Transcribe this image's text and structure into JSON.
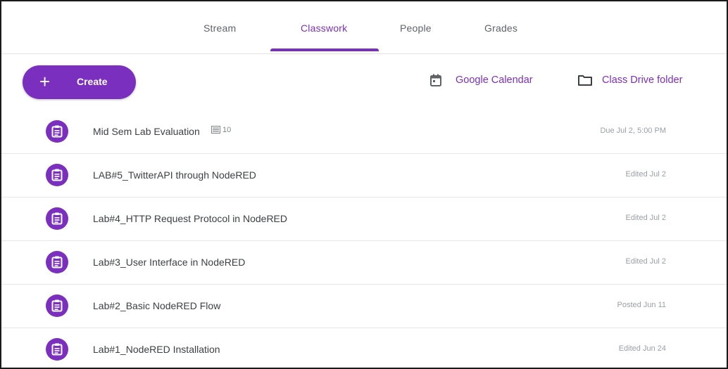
{
  "tabs": [
    {
      "label": "Stream",
      "active": false
    },
    {
      "label": "Classwork",
      "active": true
    },
    {
      "label": "People",
      "active": false
    },
    {
      "label": "Grades",
      "active": false
    }
  ],
  "toolbar": {
    "create_label": "Create",
    "calendar_label": "Google Calendar",
    "drive_label": "Class Drive folder"
  },
  "items": [
    {
      "title": "Mid Sem Lab Evaluation",
      "comment_count": "10",
      "meta": "Due Jul 2, 5:00 PM",
      "icon": "assignment-icon"
    },
    {
      "title": "LAB#5_TwitterAPI through NodeRED",
      "meta": "Edited Jul 2",
      "icon": "assignment-icon"
    },
    {
      "title": "Lab#4_HTTP Request Protocol in NodeRED",
      "meta": "Edited Jul 2",
      "icon": "assignment-icon"
    },
    {
      "title": "Lab#3_User Interface in NodeRED",
      "meta": "Edited Jul 2",
      "icon": "assignment-icon"
    },
    {
      "title": "Lab#2_Basic NodeRED Flow",
      "meta": "Posted Jun 11",
      "icon": "assignment-icon"
    },
    {
      "title": "Lab#1_NodeRED Installation",
      "meta": "Edited Jun 24",
      "icon": "assignment-icon"
    }
  ],
  "colors": {
    "accent": "#7b2fbf",
    "text": "#3c4043",
    "muted": "#9aa0a6",
    "divider": "#e6e6e6"
  }
}
